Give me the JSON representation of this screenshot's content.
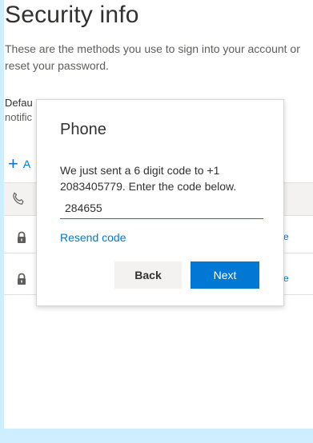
{
  "page": {
    "title": "Security info",
    "description": "These are the methods you use to sign into your account or reset your password.",
    "default_label": "Defau",
    "notification_label": "notific",
    "add_method_label": "A",
    "row_link_1": "e",
    "row_link_2": "e"
  },
  "icons": {
    "add": "plus-icon",
    "phone": "phone-icon",
    "lock": "lock-icon"
  },
  "dialog": {
    "title": "Phone",
    "message": "We just sent a 6 digit code to +1 2083405779. Enter the code below.",
    "code_value": "284655",
    "resend_label": "Resend code",
    "back_label": "Back",
    "next_label": "Next"
  },
  "colors": {
    "accent": "#0078d4",
    "background_strip": "#cfeeff"
  }
}
